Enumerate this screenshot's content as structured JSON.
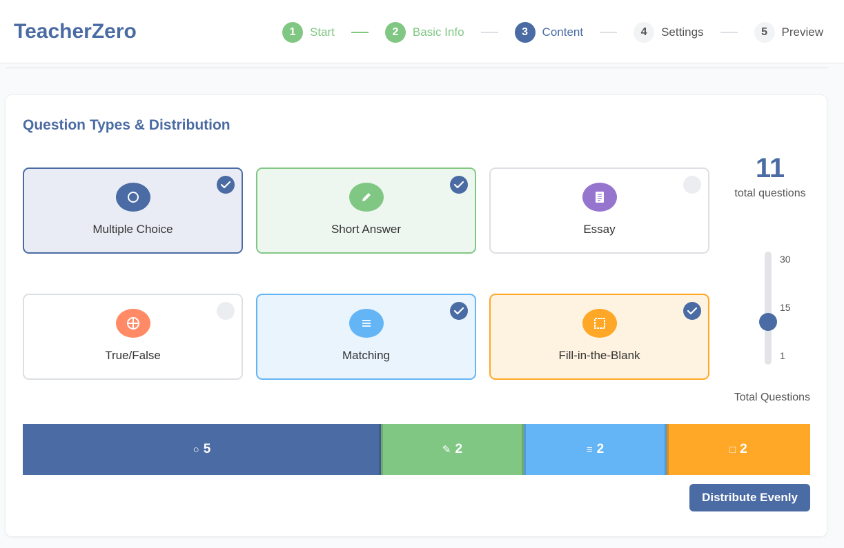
{
  "app": {
    "title": "TeacherZero"
  },
  "stepper": {
    "steps": [
      {
        "num": "1",
        "label": "Start",
        "state": "done"
      },
      {
        "num": "2",
        "label": "Basic Info",
        "state": "done"
      },
      {
        "num": "3",
        "label": "Content",
        "state": "active"
      },
      {
        "num": "4",
        "label": "Settings",
        "state": "todo"
      },
      {
        "num": "5",
        "label": "Preview",
        "state": "todo"
      }
    ]
  },
  "section": {
    "title": "Question Types & Distribution"
  },
  "question_types": [
    {
      "label": "Multiple Choice",
      "icon": "circle-icon",
      "glyph": "○",
      "color": "#4a6ba3",
      "selected": true
    },
    {
      "label": "Short Answer",
      "icon": "pencil-icon",
      "glyph": "✎",
      "color": "#81c784",
      "selected": true
    },
    {
      "label": "Essay",
      "icon": "document-icon",
      "glyph": "▤",
      "color": "#9575cd",
      "selected": false
    },
    {
      "label": "True/False",
      "icon": "crosshair-circle-icon",
      "glyph": "⊕",
      "color": "#ff8a65",
      "selected": false
    },
    {
      "label": "Matching",
      "icon": "list-lines-icon",
      "glyph": "≡",
      "color": "#64b5f6",
      "selected": true
    },
    {
      "label": "Fill-in-the-Blank",
      "icon": "blank-box-icon",
      "glyph": "□",
      "color": "#ffa726",
      "selected": true
    }
  ],
  "totals": {
    "count": "11",
    "caption": "total questions"
  },
  "slider": {
    "min_label": "1",
    "mid_label": "15",
    "max_label": "30",
    "min": 1,
    "max": 30,
    "value": 11,
    "caption": "Total Questions"
  },
  "distribution": [
    {
      "type": "Multiple Choice",
      "glyph": "○",
      "value": "5",
      "color": "#4a6ba3"
    },
    {
      "type": "Short Answer",
      "glyph": "✎",
      "value": "2",
      "color": "#81c784"
    },
    {
      "type": "Matching",
      "glyph": "≡",
      "value": "2",
      "color": "#64b5f6"
    },
    {
      "type": "Fill-in-the-Blank",
      "glyph": "□",
      "value": "2",
      "color": "#ffa726"
    }
  ],
  "actions": {
    "distribute_label": "Distribute Evenly"
  }
}
